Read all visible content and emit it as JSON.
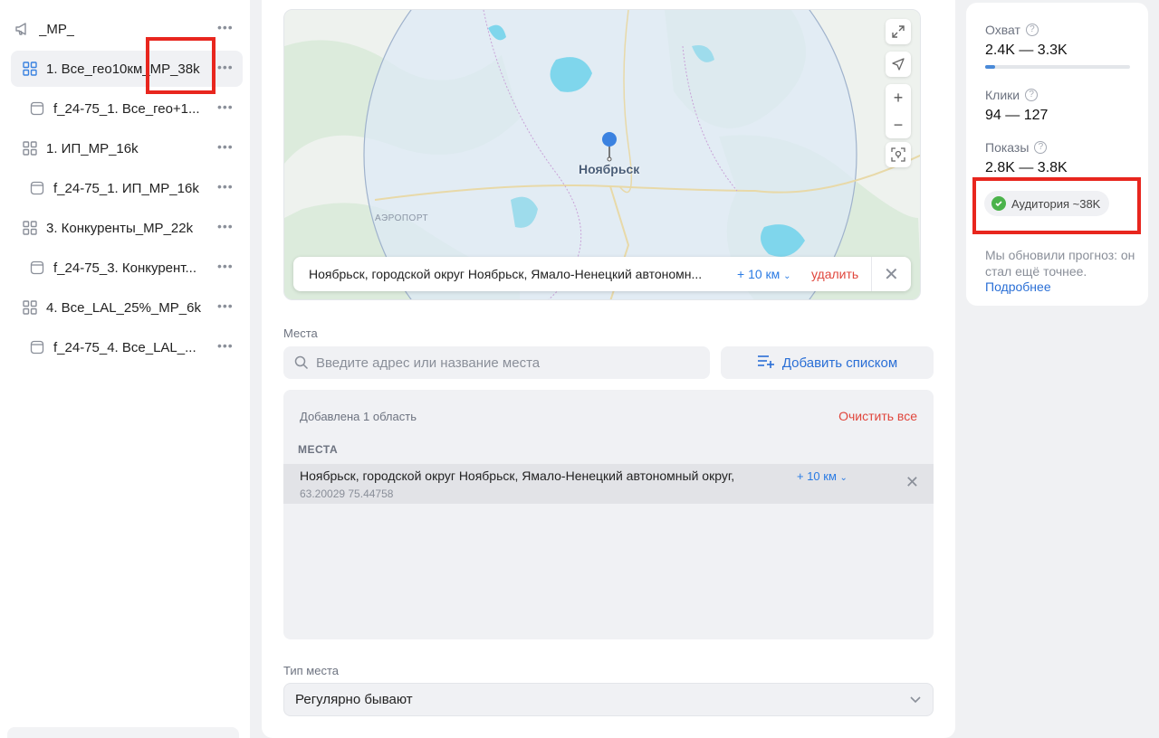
{
  "sidebar": {
    "items": [
      {
        "label": "_MP_",
        "icon": "megaphone-icon"
      },
      {
        "label": "1. Все_гео10км_MP_38k",
        "icon": "grid-icon"
      },
      {
        "label": "f_24-75_1. Все_гео+1...",
        "icon": "banner-icon"
      },
      {
        "label": "1. ИП_MP_16k",
        "icon": "grid-icon"
      },
      {
        "label": "f_24-75_1. ИП_MP_16k",
        "icon": "banner-icon"
      },
      {
        "label": "3. Конкуренты_MP_22k",
        "icon": "grid-icon"
      },
      {
        "label": "f_24-75_3. Конкурент...",
        "icon": "banner-icon"
      },
      {
        "label": "4. Все_LAL_25%_MP_6k",
        "icon": "grid-icon"
      },
      {
        "label": "f_24-75_4. Все_LAL_...",
        "icon": "banner-icon"
      }
    ]
  },
  "map": {
    "city": "Ноябрьск",
    "airport": "АЭРОПОРТ",
    "chip": {
      "address": "Ноябрьск, городской округ Ноябрьск, Ямало-Ненецкий автономн...",
      "radius": "+ 10 км",
      "delete": "удалить"
    }
  },
  "places": {
    "label": "Места",
    "search_placeholder": "Введите адрес или название места",
    "add_list": "Добавить списком",
    "added_count": "Добавлена 1 область",
    "clear_all": "Очистить все",
    "section": "МЕСТА",
    "item": {
      "name": "Ноябрьск, городской округ Ноябрьск, Ямало-Ненецкий автономный округ,",
      "radius": "+ 10 км",
      "coords": "63.20029 75.44758"
    }
  },
  "place_type": {
    "label": "Тип места",
    "value": "Регулярно бывают"
  },
  "forecast": {
    "reach_label": "Охват",
    "reach_value": "2.4K — 3.3K",
    "reach_progress": 0.07,
    "clicks_label": "Клики",
    "clicks_value": "94 — 127",
    "impressions_label": "Показы",
    "impressions_value": "2.8K — 3.8K",
    "audience": "Аудитория ~38K",
    "note": "Мы обновили прогноз: он стал ещё точнее.",
    "more_link": "Подробнее"
  },
  "colors": {
    "accent": "#2a6fd6",
    "danger": "#e0463c",
    "success": "#4bb34b",
    "highlight": "#e8261e"
  }
}
